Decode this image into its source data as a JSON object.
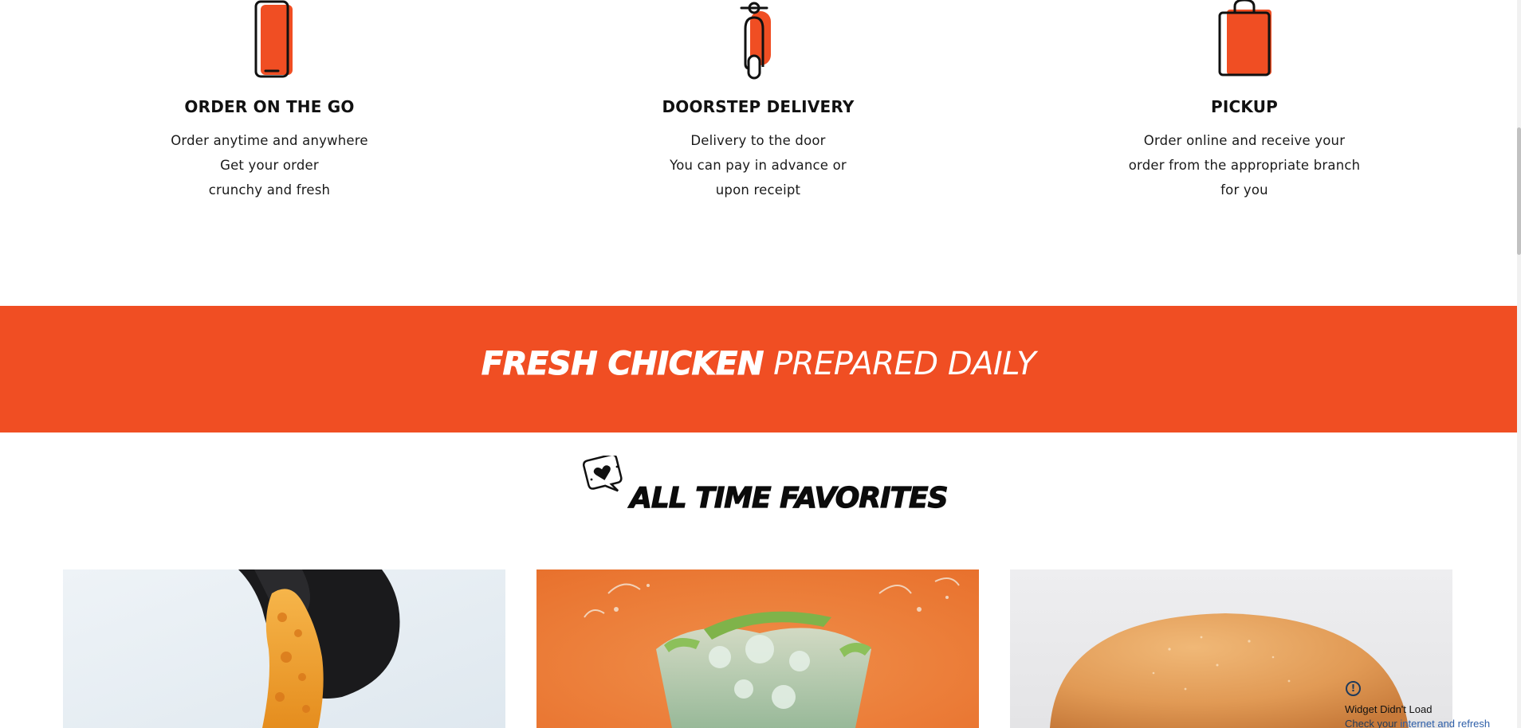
{
  "features": [
    {
      "icon": "phone-icon",
      "title": "ORDER ON THE GO",
      "lines": [
        "Order anytime and anywhere",
        "Get your order",
        "crunchy and fresh"
      ]
    },
    {
      "icon": "scooter-icon",
      "title": "DOORSTEP DELIVERY",
      "lines": [
        "Delivery to the door",
        "You can pay in advance or",
        "upon receipt"
      ]
    },
    {
      "icon": "shopping-bag-icon",
      "title": "PICKUP",
      "lines": [
        "Order online and receive your",
        "order from the appropriate branch",
        "for you"
      ]
    }
  ],
  "banner": {
    "bold_text": "FRESH CHICKEN",
    "normal_text": "PREPARED DAILY",
    "background": "#f04e23"
  },
  "favorites": {
    "title": "ALL TIME FAVORITES",
    "badge_icon": "heart-speech-bubble-icon"
  },
  "cards": [
    {
      "image": "fried-chicken-tender-photo"
    },
    {
      "image": "iced-drink-splash-photo"
    },
    {
      "image": "burger-bun-photo"
    }
  ],
  "widget": {
    "title": "Widget Didn't Load",
    "message_prefix": "Check your ",
    "message_link": "internet and refresh"
  },
  "colors": {
    "accent": "#f04e23",
    "text": "#111111"
  }
}
